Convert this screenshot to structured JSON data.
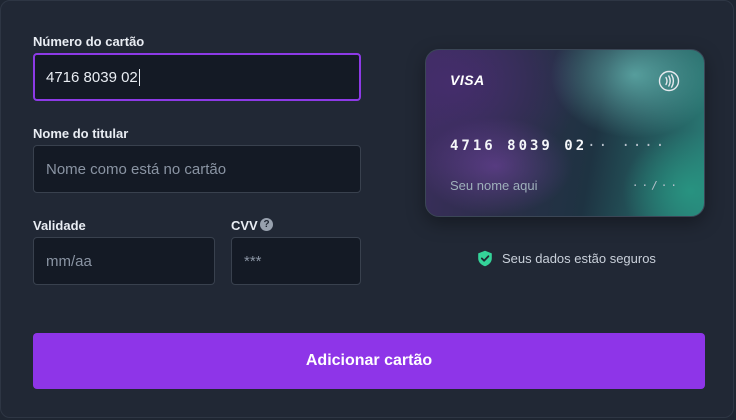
{
  "form": {
    "card_number_label": "Número do cartão",
    "card_number_value": "4716 8039 02",
    "holder_label": "Nome do titular",
    "holder_placeholder": "Nome como está no cartão",
    "expiry_label": "Validade",
    "expiry_placeholder": "mm/aa",
    "cvv_label": "CVV",
    "cvv_placeholder": "***",
    "help_icon": "?",
    "submit_label": "Adicionar cartão"
  },
  "card_preview": {
    "brand": "VISA",
    "number_entered": "4716 8039 02",
    "number_mask": "·· ····",
    "holder_placeholder": "Seu nome aqui",
    "expiry_mask": "··/··",
    "contactless_icon": "contactless-icon"
  },
  "security": {
    "text": "Seus dados estão seguros",
    "icon": "shield-check-icon"
  },
  "colors": {
    "accent": "#8e35e8",
    "background": "#1f2632",
    "field_background": "#141a25",
    "shield": "#34d399"
  }
}
